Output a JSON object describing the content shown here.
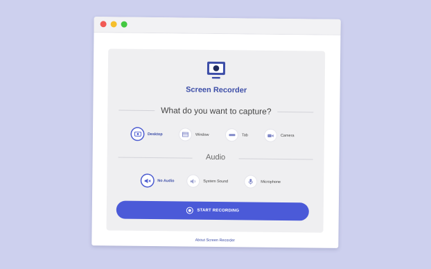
{
  "app": {
    "title": "Screen Recorder"
  },
  "capture": {
    "question": "What do you want to capture?",
    "options": [
      {
        "label": "Desktop",
        "icon": "monitor-icon",
        "selected": true
      },
      {
        "label": "Window",
        "icon": "window-icon",
        "selected": false
      },
      {
        "label": "Tab",
        "icon": "tab-icon",
        "selected": false
      },
      {
        "label": "Camera",
        "icon": "camera-icon",
        "selected": false
      }
    ]
  },
  "audio": {
    "heading": "Audio",
    "options": [
      {
        "label": "No Audio",
        "icon": "speaker-muted-icon",
        "selected": true
      },
      {
        "label": "System Sound",
        "icon": "speaker-icon",
        "selected": false
      },
      {
        "label": "Microphone",
        "icon": "microphone-icon",
        "selected": false
      }
    ]
  },
  "record_button": {
    "label": "START RECORDING"
  },
  "footer": {
    "about_link": "About Screen Recorder"
  },
  "colors": {
    "accent": "#4b5ad8",
    "title": "#3d4ea8",
    "background": "#cdd0ee"
  }
}
